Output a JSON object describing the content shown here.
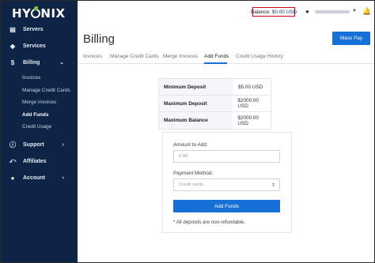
{
  "brand": {
    "logo_pre": "HY",
    "logo_post": "NIX"
  },
  "sidebar": {
    "items": [
      {
        "label": "Servers",
        "icon": "server-icon"
      },
      {
        "label": "Services",
        "icon": "cube-icon"
      },
      {
        "label": "Billing",
        "icon": "dollar-icon"
      },
      {
        "label": "Support",
        "icon": "support-icon"
      },
      {
        "label": "Affiliates",
        "icon": "share-icon"
      },
      {
        "label": "Account",
        "icon": "user-icon"
      }
    ],
    "billing_sub": [
      {
        "label": "Invoices"
      },
      {
        "label": "Manage Credit Cards"
      },
      {
        "label": "Merge Invoices"
      },
      {
        "label": "Add Funds"
      },
      {
        "label": "Credit Usage"
      }
    ]
  },
  "topbar": {
    "balance_label": "Balance:",
    "balance_value": "$0.00 USD"
  },
  "main": {
    "title": "Billing",
    "mass_pay": "Mass Pay",
    "tabs": [
      {
        "label": "Invoices"
      },
      {
        "label": "Manage Credit Cards"
      },
      {
        "label": "Merge Invoices"
      },
      {
        "label": "Add Funds"
      },
      {
        "label": "Credit Usage History"
      }
    ],
    "info": [
      {
        "label": "Minimum Deposit",
        "value": "$5.00 USD"
      },
      {
        "label": "Maximum Deposit",
        "value": "$2000.00 USD"
      },
      {
        "label": "Maximum Balance",
        "value": "$2000.00 USD"
      }
    ],
    "form": {
      "amount_label": "Amount to Add:",
      "amount_value": "5.00",
      "method_label": "Payment Method:",
      "method_value": "Credit cards",
      "submit": "Add Funds",
      "note": "* All deposits are non-refundable."
    }
  },
  "colors": {
    "sidebar": "#0d2447",
    "accent": "#1670d8",
    "balance_border": "#d0021b"
  }
}
